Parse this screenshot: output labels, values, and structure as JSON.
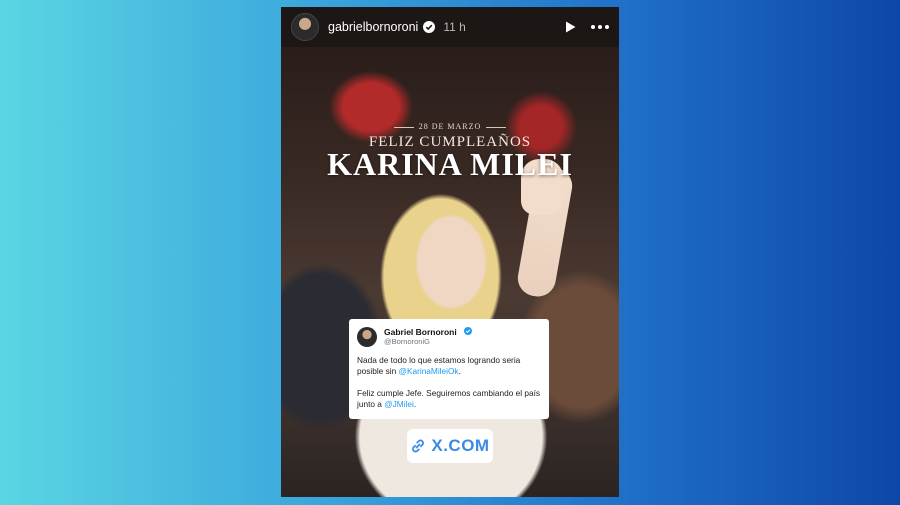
{
  "header": {
    "username": "gabrielbornoroni",
    "time_ago": "11 h"
  },
  "icons": {
    "verified": "verified-badge-icon",
    "play": "play-icon",
    "more": "more-options-icon",
    "link": "link-icon"
  },
  "banner": {
    "date": "28 DE MARZO",
    "title": "FELIZ CUMPLEAÑOS",
    "name": "KARINA MILEI"
  },
  "tweet": {
    "name": "Gabriel Bornoroni",
    "handle": "@BornoroniG",
    "line1_text": "Nada de todo lo que estamos logrando seria posible sin ",
    "line1_mention": "@KarinaMileiOk",
    "line1_end": ".",
    "line2_text": "Feliz cumple Jefe. Seguiremos cambiando el país junto a ",
    "line2_mention": "@JMilei",
    "line2_end": "."
  },
  "link_sticker": {
    "label": "X.COM"
  },
  "colors": {
    "background_left": "#5ad6e3",
    "background_right": "#0d47a8",
    "mention": "#1d9bf0",
    "link_text": "#3b8be6"
  }
}
